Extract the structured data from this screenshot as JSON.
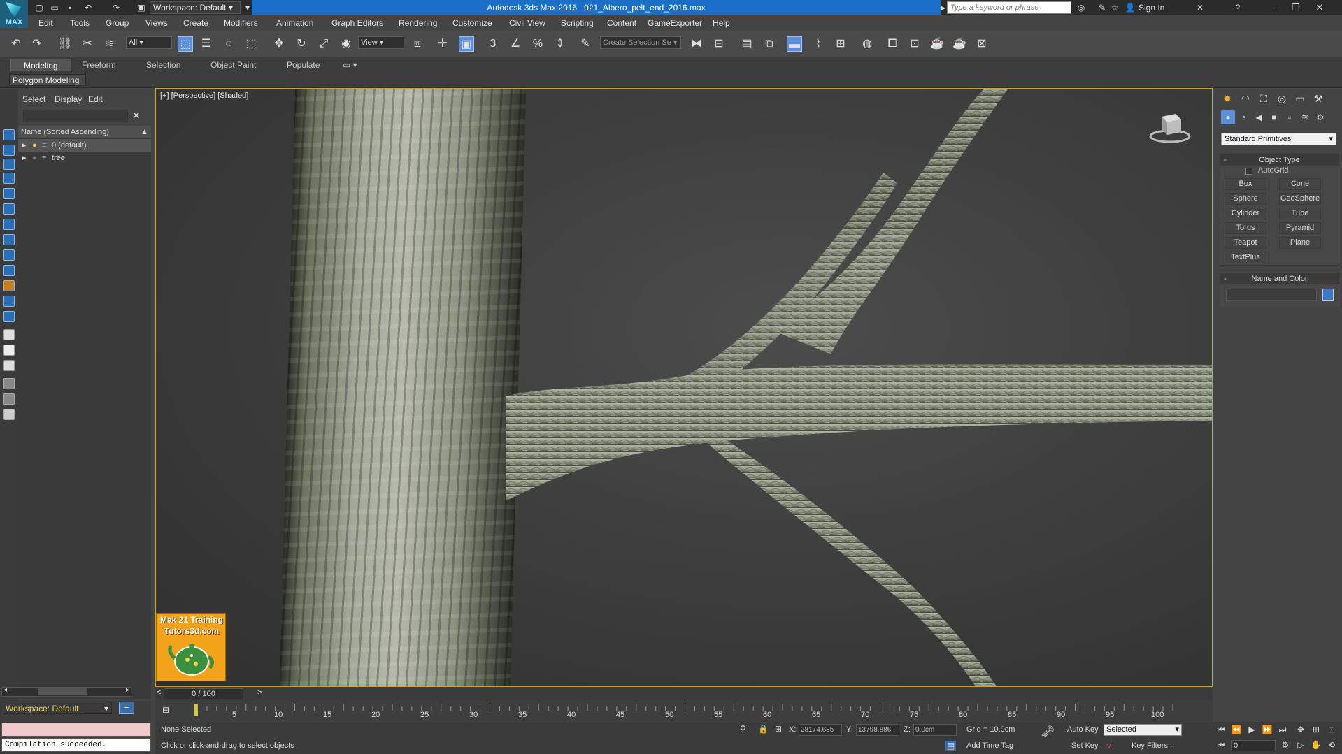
{
  "app": {
    "logo_text": "MAX",
    "title": "Autodesk 3ds Max 2016",
    "filename": "021_Albero_pelt_end_2016.max",
    "workspace": "Workspace: Default",
    "search_placeholder": "Type a keyword or phrase",
    "sign_in": "Sign In"
  },
  "menu": [
    "Edit",
    "Tools",
    "Group",
    "Views",
    "Create",
    "Modifiers",
    "Animation",
    "Graph Editors",
    "Rendering",
    "Customize",
    "Civil View",
    "Scripting",
    "Content",
    "GameExporter",
    "Help"
  ],
  "toolbar": {
    "filter_value": "All",
    "ref_coord_value": "View",
    "selection_set_placeholder": "Create Selection Se"
  },
  "ribbon": {
    "tabs": [
      "Modeling",
      "Freeform",
      "Selection",
      "Object Paint",
      "Populate"
    ],
    "active_tab": "Modeling",
    "panel_label": "Polygon Modeling"
  },
  "scene_explorer": {
    "tabs": [
      "Select",
      "Display",
      "Edit"
    ],
    "column_header": "Name (Sorted Ascending)",
    "rows": [
      {
        "name": "0 (default)"
      },
      {
        "name": "tree"
      }
    ]
  },
  "viewport": {
    "label": "[+] [Perspective] [Shaded]",
    "watermark_line1": "Mak 21 Training",
    "watermark_line2": "Tutors3d.com"
  },
  "command_panel": {
    "category": "Standard Primitives",
    "object_type_title": "Object Type",
    "autogrid_label": "AutoGrid",
    "primitives": [
      "Box",
      "Cone",
      "Sphere",
      "GeoSphere",
      "Cylinder",
      "Tube",
      "Torus",
      "Pyramid",
      "Teapot",
      "Plane",
      "TextPlus"
    ],
    "name_color_title": "Name and Color",
    "colors": {
      "object_color": "#3b79c8"
    }
  },
  "timeline": {
    "frame_display": "0 / 100",
    "ticks": [
      "5",
      "10",
      "15",
      "20",
      "25",
      "30",
      "35",
      "40",
      "45",
      "50",
      "55",
      "60",
      "65",
      "70",
      "75",
      "80",
      "85",
      "90",
      "95",
      "100"
    ]
  },
  "status": {
    "selection": "None Selected",
    "prompt": "Click or click-and-drag to select objects",
    "x_label": "X:",
    "x_value": "28174.685",
    "y_label": "Y:",
    "y_value": "13798.886",
    "z_label": "Z:",
    "z_value": "0.0cm",
    "grid": "Grid = 10.0cm",
    "add_time_tag": "Add Time Tag",
    "auto_key": "Auto Key",
    "set_key": "Set Key",
    "key_mode": "Selected",
    "key_filters": "Key Filters...",
    "current_frame": "0"
  },
  "maxscript": {
    "workspace": "Workspace: Default",
    "output": "Compilation succeeded."
  }
}
